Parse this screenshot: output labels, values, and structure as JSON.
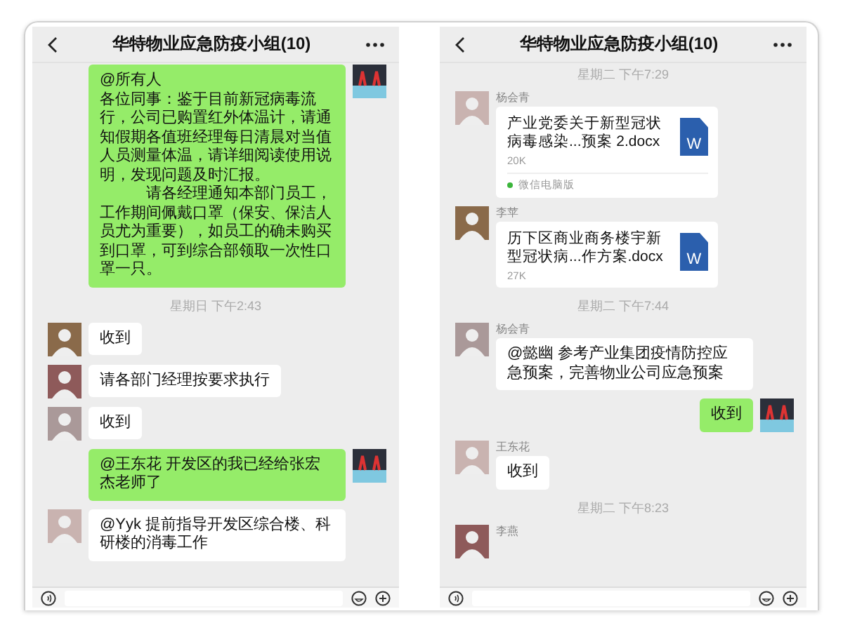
{
  "panels": [
    {
      "title": "华特物业应急防疫小组(10)",
      "messages": [
        {
          "kind": "text",
          "sent": true,
          "paragraphs": [
            "@所有人",
            "各位同事：鉴于目前新冠病毒流行，公司已购置红外体温计，请通知假期各值班经理每日清晨对当值人员测量体温，请详细阅读使用说明，发现问题及时汇报。",
            "请各经理通知本部门员工，工作期间佩戴口罩（保安、保洁人员尤为重要），如员工的确未购买到口罩，可到综合部领取一次性口罩一只。"
          ]
        },
        {
          "kind": "time",
          "text": "星期日 下午2:43"
        },
        {
          "kind": "text",
          "sent": false,
          "paragraphs": [
            "收到"
          ]
        },
        {
          "kind": "text",
          "sent": false,
          "paragraphs": [
            "请各部门经理按要求执行"
          ]
        },
        {
          "kind": "text",
          "sent": false,
          "paragraphs": [
            "收到"
          ]
        },
        {
          "kind": "text",
          "sent": true,
          "paragraphs": [
            "@王东花 开发区的我已经给张宏杰老师了"
          ]
        },
        {
          "kind": "text",
          "sent": false,
          "paragraphs": [
            "@Yyk 提前指导开发区综合楼、科研楼的消毒工作"
          ]
        }
      ]
    },
    {
      "title": "华特物业应急防疫小组(10)",
      "messages": [
        {
          "kind": "time",
          "text": "星期二 下午7:29"
        },
        {
          "kind": "file",
          "sent": false,
          "sender": "杨会青",
          "text": "产业党委关于新型冠状病毒感染...预案 2.docx",
          "size": "20K",
          "icon_letter": "W",
          "source": "微信电脑版"
        },
        {
          "kind": "file",
          "sent": false,
          "sender": "李苹",
          "text": "历下区商业商务楼宇新型冠状病...作方案.docx",
          "size": "27K",
          "icon_letter": "W"
        },
        {
          "kind": "time",
          "text": "星期二 下午7:44"
        },
        {
          "kind": "text",
          "sent": false,
          "sender": "杨会青",
          "paragraphs": [
            "@懿幽 参考产业集团疫情防控应急预案，完善物业公司应急预案"
          ]
        },
        {
          "kind": "text",
          "sent": true,
          "paragraphs": [
            "收到"
          ]
        },
        {
          "kind": "text",
          "sent": false,
          "sender": "王东花",
          "paragraphs": [
            "收到"
          ]
        },
        {
          "kind": "time",
          "text": "星期二 下午8:23"
        },
        {
          "kind": "name_only",
          "sent": false,
          "sender": "李燕"
        }
      ]
    }
  ]
}
